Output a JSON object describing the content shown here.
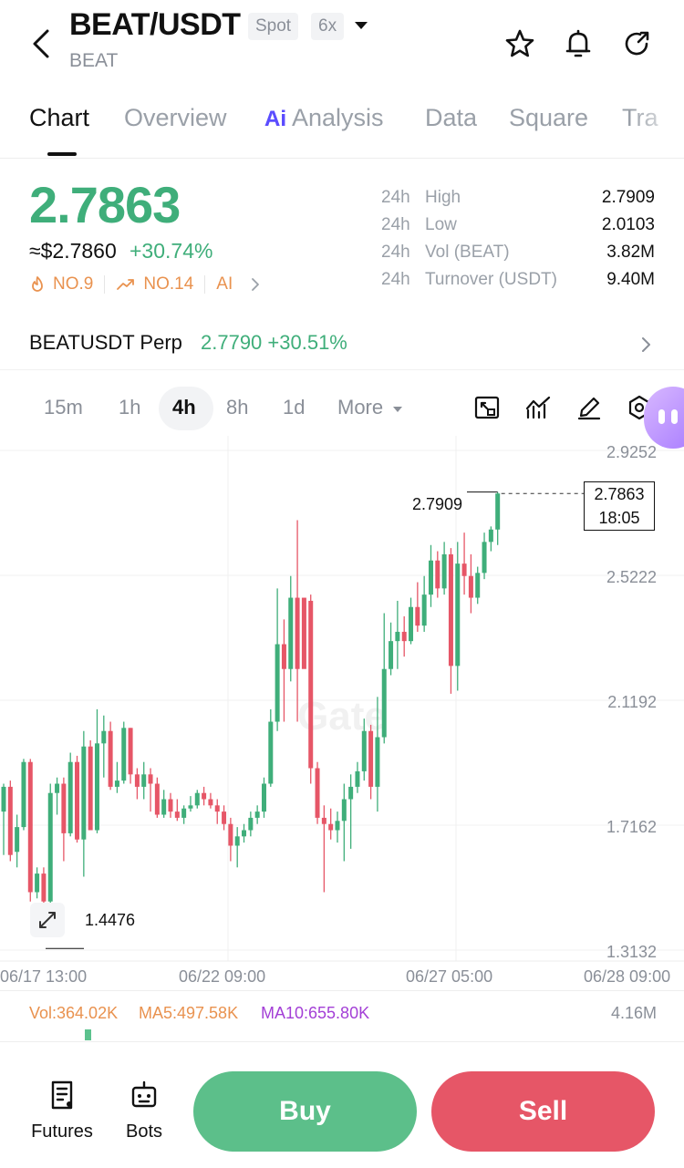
{
  "header": {
    "pair": "BEAT/USDT",
    "base": "BEAT",
    "market_type": "Spot",
    "leverage": "6x"
  },
  "tabs": [
    {
      "label": "Chart",
      "active": true
    },
    {
      "label": "Overview"
    },
    {
      "label": "Analysis",
      "ai_prefix": "Ai"
    },
    {
      "label": "Data"
    },
    {
      "label": "Square"
    },
    {
      "label": "Tra"
    }
  ],
  "ticker": {
    "price": "2.7863",
    "usd_price": "≈$2.7860",
    "change": "+30.74%",
    "rank_hot": "NO.9",
    "rank_gainer": "NO.14",
    "ai_label": "AI"
  },
  "stats": [
    {
      "pre": "24h",
      "label": "High",
      "value": "2.7909"
    },
    {
      "pre": "24h",
      "label": "Low",
      "value": "2.0103"
    },
    {
      "pre": "24h",
      "label": "Vol (BEAT)",
      "value": "3.82M"
    },
    {
      "pre": "24h",
      "label": "Turnover (USDT)",
      "value": "9.40M"
    }
  ],
  "perp": {
    "name": "BEATUSDT Perp",
    "price_change": "2.7790 +30.51%"
  },
  "timeframes": [
    "15m",
    "1h",
    "4h",
    "8h",
    "1d",
    "More"
  ],
  "active_timeframe": "4h",
  "chart": {
    "price_axis": [
      "2.9252",
      "2.5222",
      "2.1192",
      "1.7162",
      "1.3132"
    ],
    "date_axis": [
      "06/17 13:00",
      "06/22 09:00",
      "06/27 05:00",
      "06/28 09:00"
    ],
    "high_marker": "2.7909",
    "low_marker": "1.4476",
    "current_price": "2.7863",
    "countdown": "18:05",
    "watermark": "Gate",
    "candles": [
      [
        1.76,
        1.84,
        1.62,
        1.85
      ],
      [
        1.84,
        1.62,
        1.6,
        1.86
      ],
      [
        1.63,
        1.71,
        1.58,
        1.75
      ],
      [
        1.71,
        1.92,
        1.7,
        1.93
      ],
      [
        1.92,
        1.5,
        1.47,
        1.93
      ],
      [
        1.5,
        1.56,
        1.48,
        1.58
      ],
      [
        1.56,
        1.47,
        1.45,
        1.58
      ],
      [
        1.47,
        1.82,
        1.46,
        1.85
      ],
      [
        1.82,
        1.85,
        1.75,
        1.87
      ],
      [
        1.85,
        1.69,
        1.6,
        1.87
      ],
      [
        1.69,
        1.92,
        1.68,
        1.95
      ],
      [
        1.92,
        1.67,
        1.66,
        1.94
      ],
      [
        1.67,
        1.97,
        1.55,
        2.02
      ],
      [
        1.97,
        1.7,
        1.7,
        1.99
      ],
      [
        1.7,
        1.98,
        1.69,
        2.09
      ],
      [
        1.98,
        2.02,
        1.87,
        2.07
      ],
      [
        2.02,
        1.84,
        1.83,
        2.05
      ],
      [
        1.84,
        1.86,
        1.82,
        1.92
      ],
      [
        1.86,
        2.03,
        1.85,
        2.05
      ],
      [
        2.03,
        1.88,
        1.85,
        2.03
      ],
      [
        1.88,
        1.84,
        1.8,
        1.9
      ],
      [
        1.84,
        1.88,
        1.8,
        1.92
      ],
      [
        1.88,
        1.85,
        1.76,
        1.9
      ],
      [
        1.85,
        1.75,
        1.74,
        1.87
      ],
      [
        1.75,
        1.8,
        1.74,
        1.83
      ],
      [
        1.8,
        1.76,
        1.74,
        1.82
      ],
      [
        1.76,
        1.74,
        1.73,
        1.8
      ],
      [
        1.74,
        1.77,
        1.72,
        1.78
      ],
      [
        1.77,
        1.78,
        1.76,
        1.81
      ],
      [
        1.78,
        1.82,
        1.77,
        1.83
      ],
      [
        1.82,
        1.8,
        1.78,
        1.84
      ],
      [
        1.8,
        1.78,
        1.77,
        1.82
      ],
      [
        1.78,
        1.76,
        1.72,
        1.8
      ],
      [
        1.76,
        1.72,
        1.7,
        1.78
      ],
      [
        1.72,
        1.65,
        1.6,
        1.74
      ],
      [
        1.65,
        1.68,
        1.58,
        1.71
      ],
      [
        1.68,
        1.7,
        1.66,
        1.72
      ],
      [
        1.7,
        1.74,
        1.68,
        1.76
      ],
      [
        1.74,
        1.76,
        1.72,
        1.78
      ],
      [
        1.76,
        1.85,
        1.74,
        1.87
      ],
      [
        1.85,
        2.05,
        1.84,
        2.09
      ],
      [
        2.05,
        2.3,
        2.02,
        2.48
      ],
      [
        2.3,
        2.22,
        2.05,
        2.38
      ],
      [
        2.22,
        2.45,
        2.18,
        2.52
      ],
      [
        2.45,
        2.22,
        2.05,
        2.7
      ],
      [
        2.45,
        2.22,
        2.25,
        2.45
      ],
      [
        2.44,
        1.9,
        1.85,
        2.46
      ],
      [
        1.9,
        1.74,
        1.72,
        1.92
      ],
      [
        1.74,
        1.72,
        1.5,
        1.78
      ],
      [
        1.72,
        1.7,
        1.67,
        1.77
      ],
      [
        1.7,
        1.73,
        1.66,
        1.76
      ],
      [
        1.73,
        1.8,
        1.6,
        1.85
      ],
      [
        1.8,
        1.84,
        1.64,
        1.88
      ],
      [
        1.84,
        1.89,
        1.82,
        1.92
      ],
      [
        1.89,
        2.02,
        1.86,
        2.06
      ],
      [
        2.02,
        1.84,
        1.8,
        2.04
      ],
      [
        1.84,
        2.0,
        1.76,
        2.13
      ],
      [
        2.0,
        2.22,
        1.98,
        2.4
      ],
      [
        2.22,
        2.31,
        2.2,
        2.37
      ],
      [
        2.31,
        2.34,
        2.22,
        2.44
      ],
      [
        2.34,
        2.31,
        2.26,
        2.39
      ],
      [
        2.31,
        2.42,
        2.3,
        2.45
      ],
      [
        2.42,
        2.36,
        2.34,
        2.5
      ],
      [
        2.36,
        2.46,
        2.34,
        2.52
      ],
      [
        2.46,
        2.57,
        2.42,
        2.62
      ],
      [
        2.57,
        2.48,
        2.45,
        2.6
      ],
      [
        2.48,
        2.59,
        2.46,
        2.63
      ],
      [
        2.59,
        2.23,
        2.14,
        2.61
      ],
      [
        2.23,
        2.56,
        2.15,
        2.63
      ],
      [
        2.56,
        2.52,
        2.46,
        2.66
      ],
      [
        2.52,
        2.45,
        2.4,
        2.59
      ],
      [
        2.45,
        2.53,
        2.43,
        2.55
      ],
      [
        2.53,
        2.63,
        2.51,
        2.66
      ],
      [
        2.63,
        2.67,
        2.6,
        2.68
      ],
      [
        2.67,
        2.7863,
        2.62,
        2.7909
      ]
    ]
  },
  "volume": {
    "vol": "Vol:364.02K",
    "ma5": "MA5:497.58K",
    "ma10": "MA10:655.80K",
    "right": "4.16M"
  },
  "bottom_nav": {
    "futures": "Futures",
    "bots": "Bots",
    "buy": "Buy",
    "sell": "Sell"
  },
  "colors": {
    "up": "#3fae7a",
    "down": "#e65667",
    "accent_orange": "#e9924f",
    "ma10_purple": "#a33fd6"
  }
}
